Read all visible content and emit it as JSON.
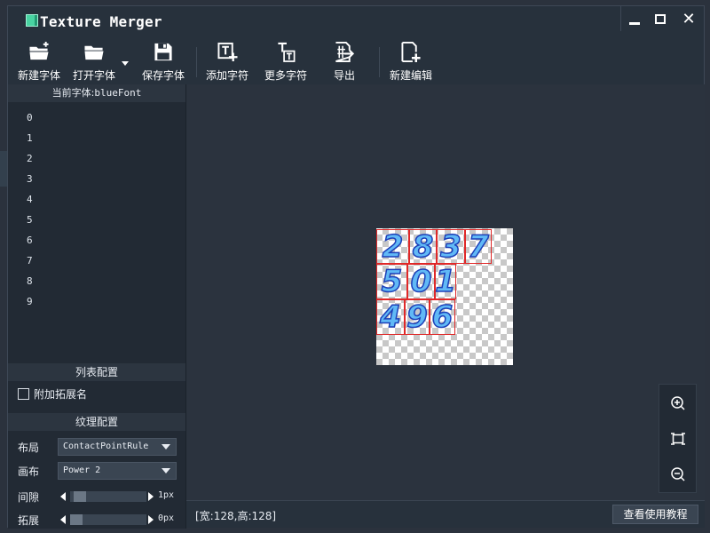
{
  "window": {
    "title": "Texture Merger"
  },
  "toolbar": {
    "new_font": "新建字体",
    "open_font": "打开字体",
    "save_font": "保存字体",
    "add_chars": "添加字符",
    "more_chars": "更多字符",
    "export": "导出",
    "new_edit": "新建编辑"
  },
  "left_panel": {
    "current_font_label": "当前字体:",
    "current_font_name": "blueFont",
    "chars": [
      "0",
      "1",
      "2",
      "3",
      "4",
      "5",
      "6",
      "7",
      "8",
      "9"
    ],
    "list_config_title": "列表配置",
    "append_ext_label": "附加拓展名",
    "append_ext_checked": false,
    "texture_config_title": "纹理配置",
    "layout_label": "布局",
    "layout_value": "ContactPointRule",
    "canvas_label": "画布",
    "canvas_value": "Power 2",
    "gap_label": "间隙",
    "gap_value": "1px",
    "extend_label": "拓展",
    "extend_value": "0px"
  },
  "canvas": {
    "glyph_rows": [
      [
        "2",
        "8",
        "3",
        "7"
      ],
      [
        "5",
        "0",
        "1"
      ],
      [
        "4",
        "9",
        "6"
      ]
    ]
  },
  "status": {
    "size_text": "[宽:128,高:128]",
    "help_button": "查看使用教程"
  },
  "colors": {
    "accent": "#49d3a2",
    "glyph_fill": "#61b9f6",
    "glyph_outline": "#1c3fb8",
    "glyph_frame": "#e02828"
  },
  "icons": [
    "folder-new-icon",
    "folder-open-icon",
    "save-icon",
    "add-char-icon",
    "more-chars-icon",
    "export-icon",
    "new-edit-icon",
    "zoom-in-icon",
    "fit-icon",
    "zoom-out-icon"
  ]
}
